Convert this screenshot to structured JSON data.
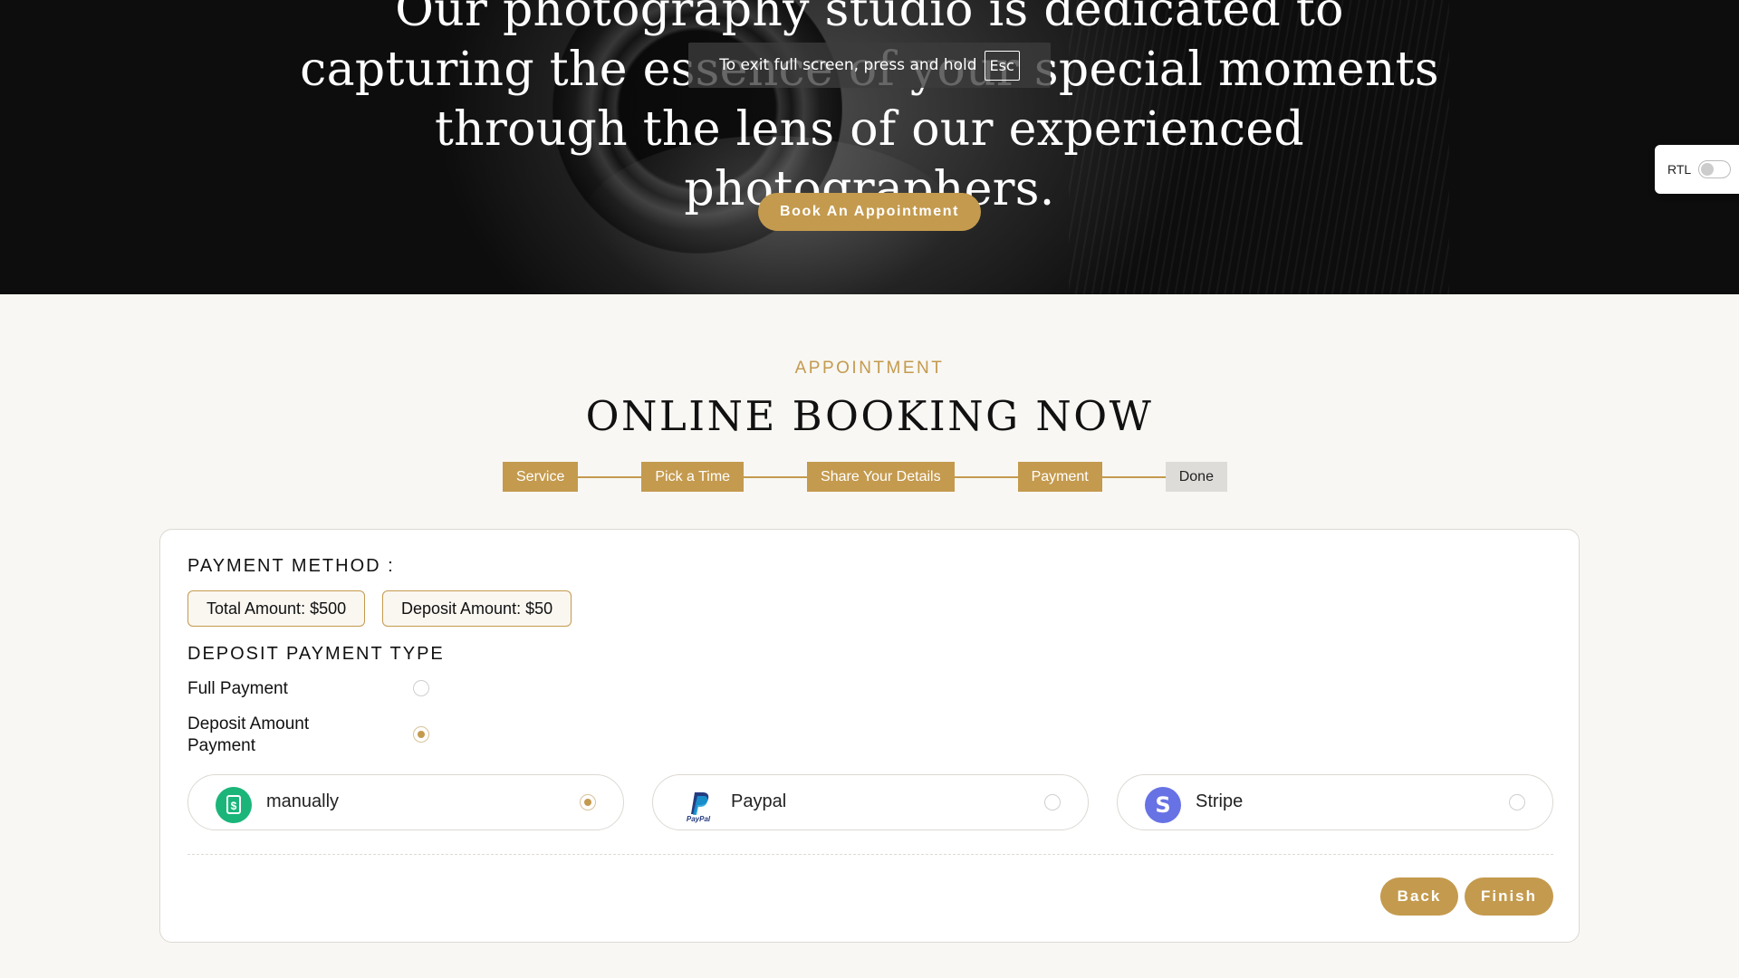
{
  "hero": {
    "headline": "Our photography studio is dedicated to capturing the essence of your special moments through the lens of our experienced photographers.",
    "cta_label": "Book An Appointment"
  },
  "fullscreen_notice": {
    "text": "To exit full screen, press and hold",
    "key": "Esc"
  },
  "rtl_toggle": {
    "label": "RTL",
    "enabled": false
  },
  "booking": {
    "eyebrow": "APPOINTMENT",
    "title": "ONLINE BOOKING NOW",
    "steps": [
      {
        "label": "Service",
        "active": true
      },
      {
        "label": "Pick a Time",
        "active": true
      },
      {
        "label": "Share Your Details",
        "active": true
      },
      {
        "label": "Payment",
        "active": true
      },
      {
        "label": "Done",
        "active": false
      }
    ],
    "payment": {
      "method_title": "PAYMENT METHOD :",
      "total_amount": "Total Amount: $500",
      "deposit_amount": "Deposit Amount: $50",
      "deposit_type_title": "DEPOSIT PAYMENT TYPE",
      "options": [
        {
          "label": "Full Payment",
          "selected": false
        },
        {
          "label": "Deposit Amount Payment",
          "selected": true
        }
      ],
      "gateways": [
        {
          "label": "manually",
          "icon": "receipt-icon",
          "color": "#1bb57a",
          "selected": true
        },
        {
          "label": "Paypal",
          "icon": "paypal-icon",
          "color": "#253b80",
          "selected": false
        },
        {
          "label": "Stripe",
          "icon": "stripe-icon",
          "color": "#6772e5",
          "selected": false
        }
      ]
    },
    "actions": {
      "back_label": "Back",
      "finish_label": "Finish"
    }
  },
  "colors": {
    "accent": "#c49a4e",
    "inactive_step": "#dedcd8",
    "page_bg": "#f8f7f3"
  }
}
